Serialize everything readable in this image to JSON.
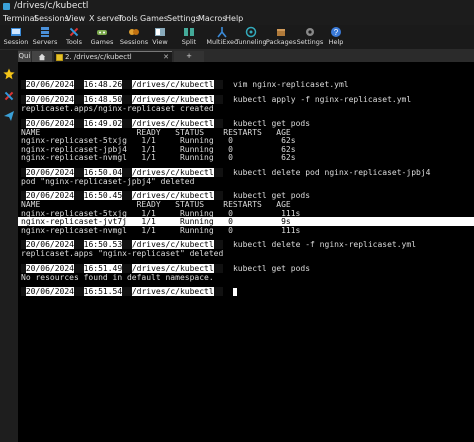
{
  "window": {
    "title": "/drives/c/kubectl"
  },
  "menu": [
    "Terminal",
    "Sessions",
    "View",
    "X server",
    "Tools",
    "Games",
    "Settings",
    "Macros",
    "Help"
  ],
  "toolbar": [
    {
      "label": "Session",
      "icon": "session-icon"
    },
    {
      "label": "Servers",
      "icon": "servers-icon"
    },
    {
      "label": "Tools",
      "icon": "tools-icon"
    },
    {
      "label": "Games",
      "icon": "games-icon"
    },
    {
      "label": "Sessions",
      "icon": "sessions-icon"
    },
    {
      "label": "View",
      "icon": "view-icon"
    },
    {
      "label": "Split",
      "icon": "split-icon"
    },
    {
      "label": "MultiExec",
      "icon": "multiexec-icon"
    },
    {
      "label": "Tunneling",
      "icon": "tunneling-icon"
    },
    {
      "label": "Packages",
      "icon": "packages-icon"
    },
    {
      "label": "Settings",
      "icon": "settings-icon"
    },
    {
      "label": "Help",
      "icon": "help-icon"
    }
  ],
  "tabs": {
    "quick": "Qui",
    "active": "2. /drives/c/kubectl",
    "add": "+"
  },
  "prompt": {
    "date": "20/06/2024",
    "path": "/drives/c/kubectl"
  },
  "terminal": [
    {
      "kind": "prompt",
      "time": "16:48.26",
      "cmd": "vim nginx-replicaset.yml"
    },
    {
      "kind": "prompt",
      "time": "16:48.50",
      "cmd": "kubectl apply -f nginx-replicaset.yml"
    },
    {
      "kind": "out",
      "text": "replicaset.apps/nginx-replicaset created"
    },
    {
      "kind": "prompt",
      "time": "16:49.02",
      "cmd": "kubectl get pods"
    },
    {
      "kind": "out",
      "text": "NAME                    READY   STATUS    RESTARTS   AGE"
    },
    {
      "kind": "out",
      "text": "nginx-replicaset-5txjg   1/1     Running   0          62s"
    },
    {
      "kind": "out",
      "text": "nginx-replicaset-jpbj4   1/1     Running   0          62s"
    },
    {
      "kind": "out",
      "text": "nginx-replicaset-nvmgl   1/1     Running   0          62s"
    },
    {
      "kind": "prompt",
      "time": "16:50.04",
      "cmd": "kubectl delete pod nginx-replicaset-jpbj4"
    },
    {
      "kind": "out",
      "text": "pod \"nginx-replicaset-jpbj4\" deleted"
    },
    {
      "kind": "prompt",
      "time": "16:50.45",
      "cmd": "kubectl get pods"
    },
    {
      "kind": "out",
      "text": "NAME                    READY   STATUS    RESTARTS   AGE"
    },
    {
      "kind": "out",
      "text": "nginx-replicaset-5txjg   1/1     Running   0          111s"
    },
    {
      "kind": "hl",
      "text": "nginx-replicaset-jvt7j   1/1     Running   0          9s"
    },
    {
      "kind": "out",
      "text": "nginx-replicaset-nvmgl   1/1     Running   0          111s"
    },
    {
      "kind": "prompt",
      "time": "16:50.53",
      "cmd": "kubectl delete -f nginx-replicaset.yml"
    },
    {
      "kind": "out",
      "text": "replicaset.apps \"nginx-replicaset\" deleted"
    },
    {
      "kind": "prompt",
      "time": "16:51.49",
      "cmd": "kubectl get pods"
    },
    {
      "kind": "out",
      "text": "No resources found in default namespace."
    },
    {
      "kind": "prompt",
      "time": "16:51.54",
      "cmd": ""
    }
  ]
}
